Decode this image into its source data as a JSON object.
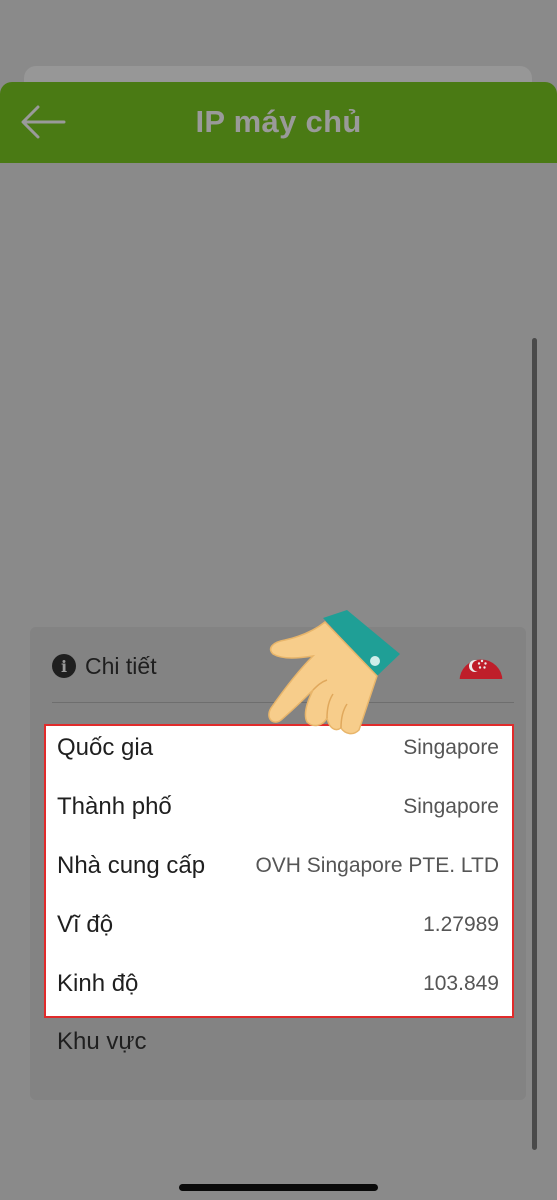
{
  "header": {
    "title": "IP máy chủ",
    "back_icon": "arrow-left-icon"
  },
  "details": {
    "title": "Chi tiết",
    "info_icon": "info-icon",
    "flag_icon": "singapore-flag-icon",
    "rows": [
      {
        "label": "Quốc gia",
        "value": "Singapore"
      },
      {
        "label": "Thành phố",
        "value": "Singapore"
      },
      {
        "label": "Nhà cung cấp",
        "value": "OVH Singapore PTE. LTD"
      },
      {
        "label": "Vĩ độ",
        "value": "1.27989"
      },
      {
        "label": "Kinh độ",
        "value": "103.849"
      }
    ],
    "region_label": "Khu vực"
  },
  "overlay": {
    "pointer_icon": "pointing-hand-icon"
  },
  "colors": {
    "header": "#4a7a14",
    "highlight_border": "#e02b2b",
    "overlay_gray": "#8a8a8a"
  }
}
